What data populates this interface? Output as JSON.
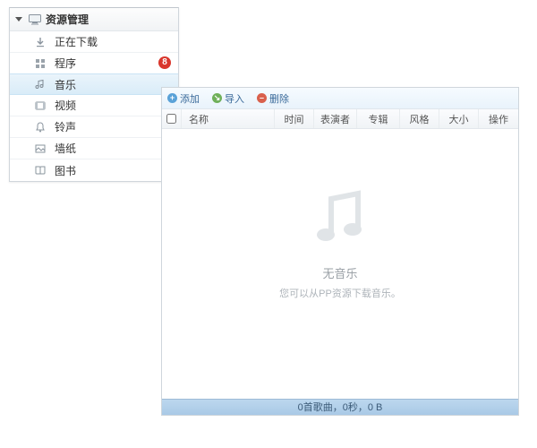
{
  "sidebar": {
    "title": "资源管理",
    "items": [
      {
        "label": "正在下载",
        "icon": "download-icon",
        "badge": null,
        "active": false
      },
      {
        "label": "程序",
        "icon": "apps-icon",
        "badge": "8",
        "active": false
      },
      {
        "label": "音乐",
        "icon": "music-icon",
        "badge": null,
        "active": true
      },
      {
        "label": "视频",
        "icon": "video-icon",
        "badge": null,
        "active": false
      },
      {
        "label": "铃声",
        "icon": "ringtone-icon",
        "badge": null,
        "active": false
      },
      {
        "label": "墙纸",
        "icon": "wallpaper-icon",
        "badge": null,
        "active": false
      },
      {
        "label": "图书",
        "icon": "books-icon",
        "badge": null,
        "active": false
      }
    ]
  },
  "toolbar": {
    "add": "添加",
    "import": "导入",
    "delete": "删除"
  },
  "columns": {
    "name": "名称",
    "time": "时间",
    "artist": "表演者",
    "album": "专辑",
    "genre": "风格",
    "size": "大小",
    "ops": "操作"
  },
  "empty": {
    "title": "无音乐",
    "hint": "您可以从PP资源下载音乐。"
  },
  "status": "0首歌曲，0秒，0 B"
}
